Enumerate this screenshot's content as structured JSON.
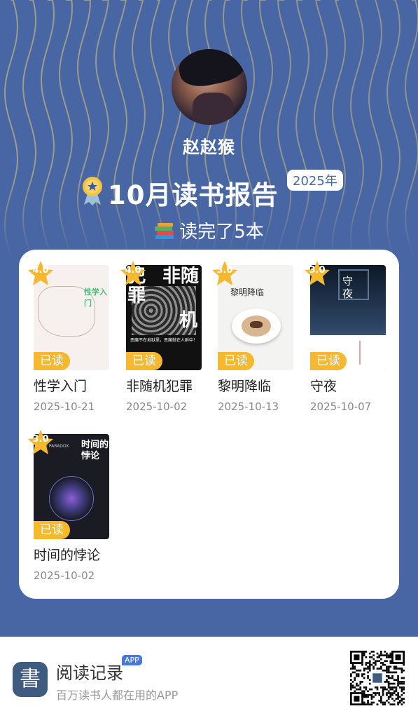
{
  "profile": {
    "username": "赵赵猴"
  },
  "report": {
    "title": "10月读书报告",
    "year": "2025年",
    "summary_icon": "books-icon",
    "summary": "读完了5本"
  },
  "books": [
    {
      "title": "性学入门",
      "date": "2025-10-21",
      "rating": "4.0",
      "status": "已读",
      "cover_text": [
        "性学入门"
      ]
    },
    {
      "title": "非随机犯罪",
      "date": "2025-10-02",
      "rating": "4.0",
      "status": "已读",
      "cover_text": [
        "非随",
        "机",
        "犯罪",
        "恶魔不在地狱里，恶魔就在人群中！"
      ]
    },
    {
      "title": "黎明降临",
      "date": "2025-10-13",
      "rating": "3.0",
      "status": "已读",
      "cover_text": [
        "黎明降临"
      ]
    },
    {
      "title": "守夜",
      "date": "2025-10-07",
      "rating": "3.0",
      "status": "已读",
      "cover_text": [
        "守",
        "夜"
      ]
    },
    {
      "title": "时间的悖论",
      "date": "2025-10-02",
      "rating": "3.0",
      "status": "已读",
      "cover_text": [
        "时间的",
        "悖论",
        "THE PARADOX"
      ]
    }
  ],
  "footer": {
    "logo_char": "書",
    "app_name": "阅读记录",
    "badge": "APP",
    "slogan": "百万读书人都在用的APP"
  },
  "colors": {
    "background": "#4866a4",
    "accent": "#f5b82e",
    "wave": "#e8c873"
  }
}
